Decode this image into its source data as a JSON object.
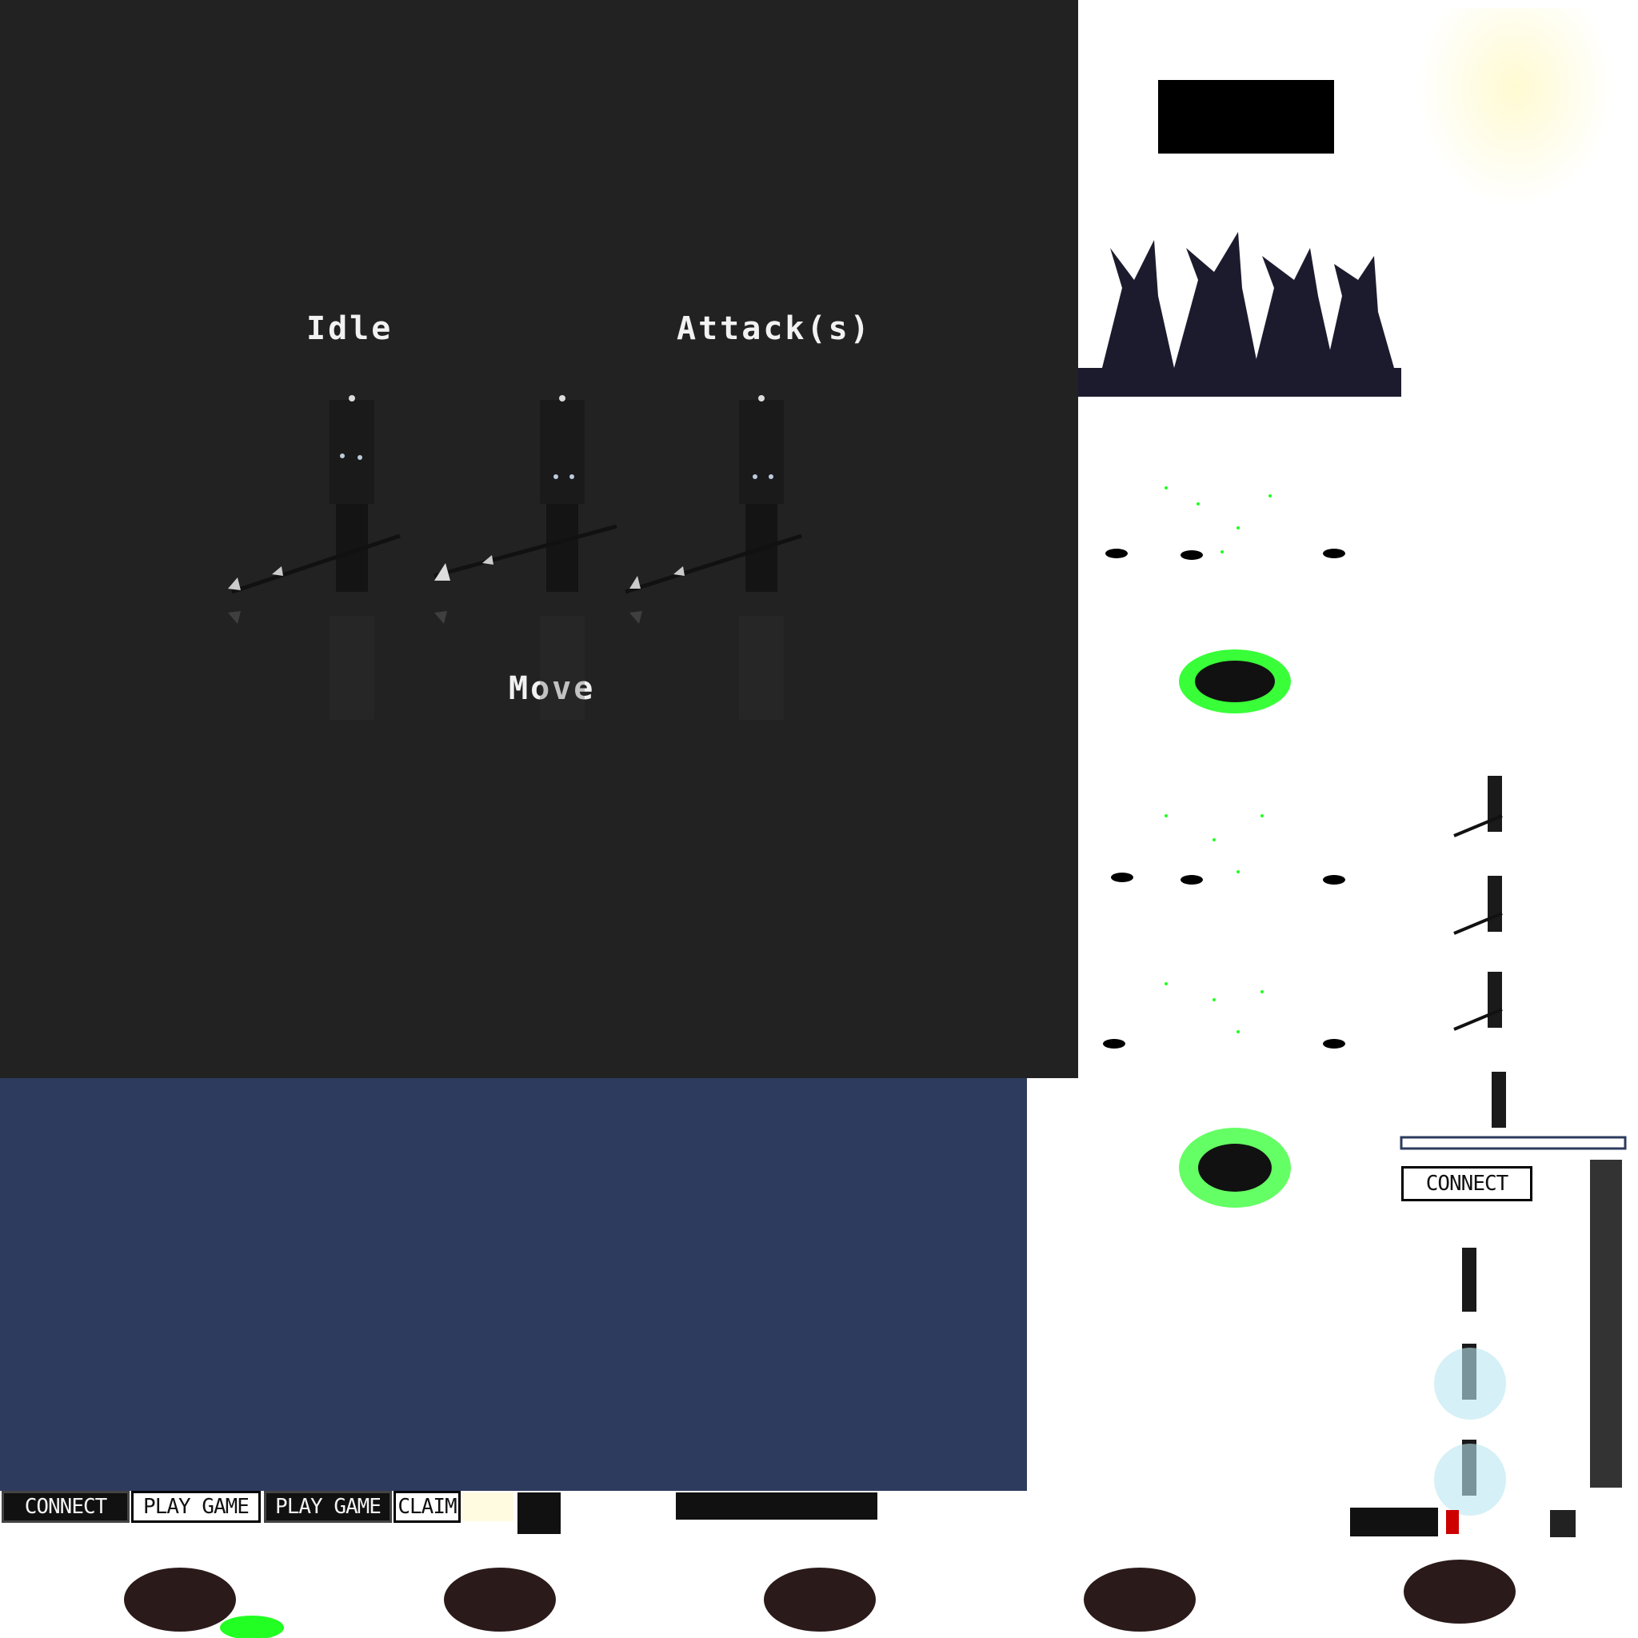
{
  "preview": {
    "bg": "#222222",
    "labels": {
      "idle": "Idle",
      "attack": "Attack(s)",
      "move": "Move"
    }
  },
  "navy_panel": {
    "color": "#2d3b5e"
  },
  "buttons": {
    "connect": "CONNECT",
    "play1": "PLAY GAME",
    "play2": "PLAY GAME",
    "claim": "CLAIM",
    "connect_right": "CONNECT"
  },
  "icons": [
    "tree-silhouette-icon",
    "knight-sprite-icon",
    "spider-monster-icon",
    "green-splatter-icon",
    "lamp-glow-icon"
  ],
  "colors": {
    "accent_green": "#22ff22",
    "dark": "#1c1b2e"
  }
}
